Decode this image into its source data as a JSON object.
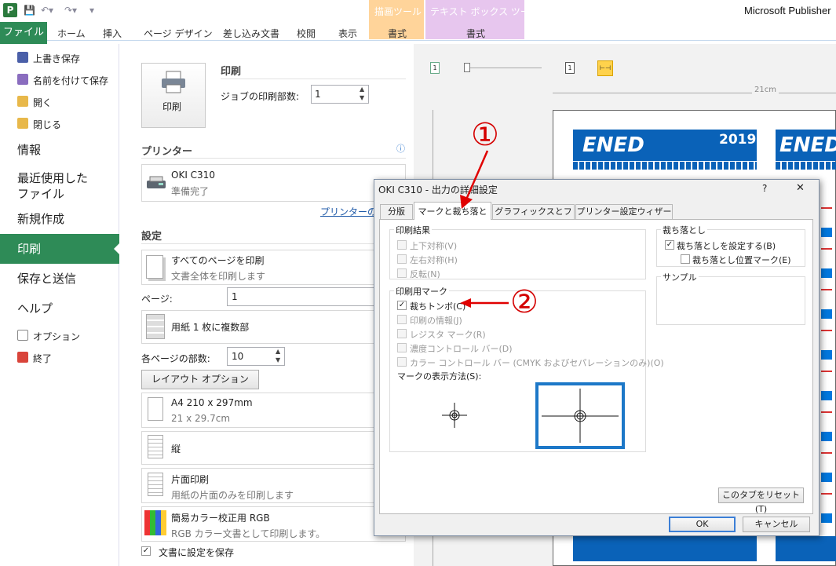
{
  "window": {
    "app_title": "Microsoft Publisher",
    "app_icon": "P",
    "context_draw": "描画ツール",
    "context_text": "テキスト ボックス ツール"
  },
  "ribbon": {
    "tabs": [
      "ファイル",
      "ホーム",
      "挿入",
      "ページ デザイン",
      "差し込み文書",
      "校閲",
      "表示",
      "書式",
      "書式"
    ]
  },
  "nav": {
    "small_top": [
      "上書き保存",
      "名前を付けて保存",
      "開く",
      "閉じる"
    ],
    "large": [
      "情報",
      "最近使用した\nファイル",
      "新規作成",
      "印刷",
      "保存と送信",
      "ヘルプ"
    ],
    "small_bottom": [
      "オプション",
      "終了"
    ]
  },
  "print": {
    "header": "印刷",
    "print_button": "印刷",
    "copies_label": "ジョブの印刷部数:",
    "copies_value": "1",
    "printer_header": "プリンター",
    "printer_name": "OKI C310",
    "printer_status": "準備完了",
    "printer_props_link": "プリンターのプ",
    "settings_header": "設定",
    "settings": [
      {
        "title": "すべてのページを印刷",
        "sub": "文書全体を印刷します"
      }
    ],
    "pages_label": "ページ:",
    "pages_value": "1",
    "layout_title": "用紙 1 枚に複数部",
    "copies_per_page_label": "各ページの部数:",
    "copies_per_page_value": "10",
    "layout_options_button": "レイアウト オプション",
    "paper_title": "A4 210 x 297mm",
    "paper_sub": "21 x 29.7cm",
    "orientation": "縦",
    "sides_title": "片面印刷",
    "sides_sub": "用紙の片面のみを印刷します",
    "color_title": "簡易カラー校正用 RGB",
    "color_sub": "RGB カラー文書として印刷します。",
    "save_settings": "文書に設定を保存",
    "save_settings_checked": true
  },
  "preview": {
    "ruler_label": "21cm",
    "banner_year": "2019",
    "banner_text": "ENED"
  },
  "dialog": {
    "title": "OKI C310 - 出力の詳細設定",
    "help": "?",
    "close": "✕",
    "tabs": [
      "分版",
      "マークと裁ち落とし",
      "グラフィックスとフォント",
      "プリンター設定ウィザード"
    ],
    "active_tab": 1,
    "print_result": {
      "label": "印刷結果",
      "options": [
        "上下対称(V)",
        "左右対称(H)",
        "反転(N)"
      ]
    },
    "marks": {
      "label": "印刷用マーク",
      "options": [
        {
          "text": "裁ちトンボ(C)",
          "checked": true,
          "enabled": true
        },
        {
          "text": "印刷の情報(J)",
          "checked": false,
          "enabled": false
        },
        {
          "text": "レジスタ マーク(R)",
          "checked": false,
          "enabled": false
        },
        {
          "text": "濃度コントロール バー(D)",
          "checked": false,
          "enabled": false
        },
        {
          "text": "カラー コントロール バー (CMYK およびセパレーションのみ)(O)",
          "checked": false,
          "enabled": false
        }
      ],
      "display_label": "マークの表示方法(S):"
    },
    "bleed": {
      "label": "裁ち落とし",
      "options": [
        {
          "text": "裁ち落としを設定する(B)",
          "checked": true
        },
        {
          "text": "裁ち落とし位置マーク(E)",
          "checked": false
        }
      ]
    },
    "sample_label": "サンプル",
    "reset_button": "このタブをリセット(T)",
    "ok_button": "OK",
    "cancel_button": "キャンセル"
  },
  "annotations": {
    "circle1": "①",
    "circle2": "②",
    "accent": "#e00000"
  }
}
